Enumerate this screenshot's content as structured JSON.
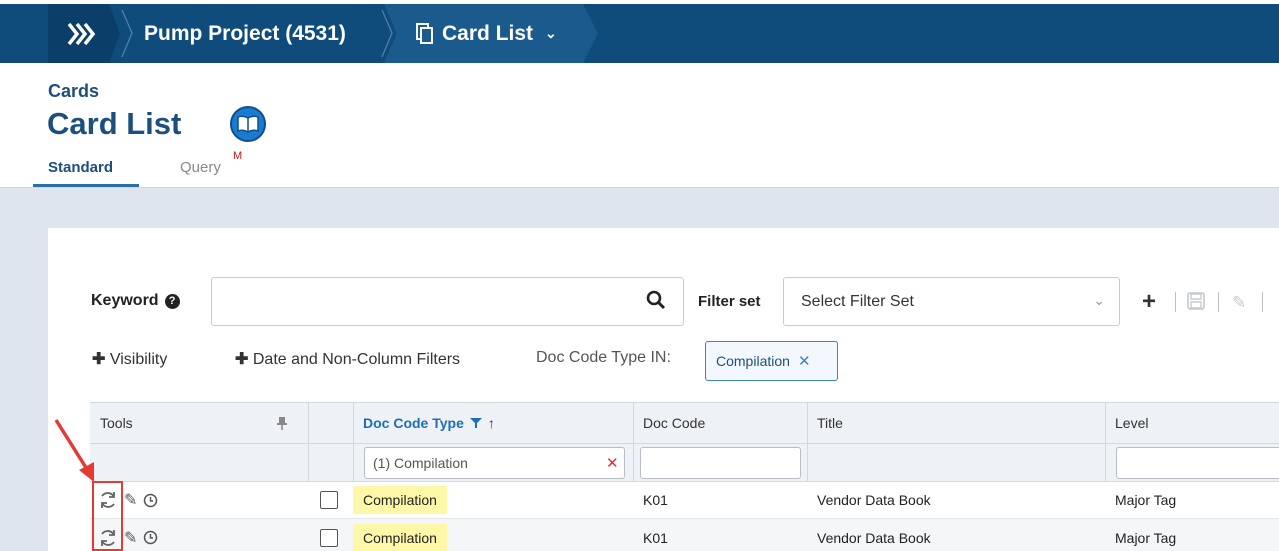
{
  "nav": {
    "project": "Pump Project (4531)",
    "cardlist": "Card List"
  },
  "header": {
    "section": "Cards",
    "title": "Card List",
    "tabs": {
      "standard": "Standard",
      "query": "Query",
      "query_badge": "M"
    }
  },
  "filters": {
    "keyword_label": "Keyword",
    "keyword_value": "",
    "filterset_label": "Filter set",
    "filterset_value": "Select Filter Set",
    "visibility": "Visibility",
    "date_filters": "Date and Non-Column Filters",
    "doc_code_type_in": "Doc Code Type IN:",
    "chip": "Compilation"
  },
  "grid": {
    "columns": [
      "Tools",
      "",
      "Doc Code Type",
      "Doc Code",
      "Title",
      "Level"
    ],
    "filter_doc_code_type": "(1) Compilation",
    "rows": [
      {
        "doc_code_type": "Compilation",
        "doc_code": "K01",
        "title": "Vendor Data Book",
        "level": "Major Tag"
      },
      {
        "doc_code_type": "Compilation",
        "doc_code": "K01",
        "title": "Vendor Data Book",
        "level": "Major Tag"
      }
    ]
  },
  "colors": {
    "nav": "#0f4c7c",
    "accent": "#1d4f7e",
    "highlight": "#fff7a8",
    "annotation": "#e53935"
  },
  "icons": [
    "chevrons-right-icon",
    "cards-icon",
    "chevron-down-icon",
    "book-icon",
    "question-icon",
    "search-icon",
    "plus-icon",
    "save-icon",
    "pencil-icon",
    "pin-icon",
    "filter-icon",
    "sort-up-icon",
    "refresh-icon",
    "edit-icon",
    "clock-icon",
    "close-icon"
  ]
}
